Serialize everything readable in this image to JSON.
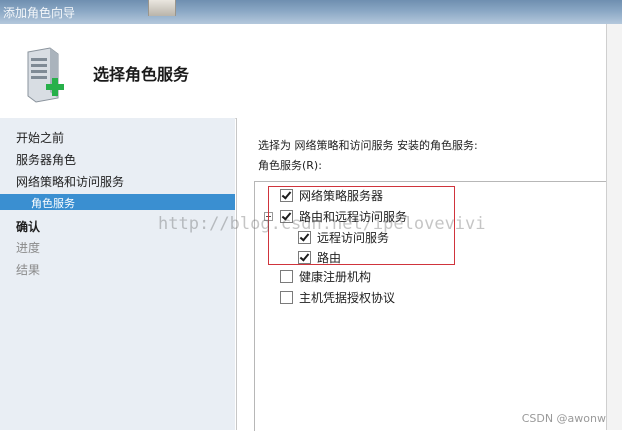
{
  "window": {
    "title": "添加角色向导"
  },
  "header": {
    "title": "选择角色服务",
    "icon": "server-add-icon"
  },
  "nav": {
    "items": [
      {
        "label": "开始之前",
        "state": "normal"
      },
      {
        "label": "服务器角色",
        "state": "normal"
      },
      {
        "label": "网络策略和访问服务",
        "state": "normal"
      },
      {
        "label": "角色服务",
        "state": "selected"
      },
      {
        "label": "确认",
        "state": "bold"
      },
      {
        "label": "进度",
        "state": "disabled"
      },
      {
        "label": "结果",
        "state": "disabled"
      }
    ]
  },
  "main": {
    "description": "选择为 网络策略和访问服务 安装的角色服务:",
    "list_label": "角色服务(R):",
    "services": [
      {
        "label": "网络策略服务器",
        "checked": true
      },
      {
        "label": "路由和远程访问服务",
        "checked": true
      },
      {
        "label": "远程访问服务",
        "checked": true
      },
      {
        "label": "路由",
        "checked": true
      },
      {
        "label": "健康注册机构",
        "checked": false
      },
      {
        "label": "主机凭据授权协议",
        "checked": false
      }
    ]
  },
  "watermark": "http://blog.csdn.net/ipelovevivi",
  "credit": "CSDN @awonw"
}
